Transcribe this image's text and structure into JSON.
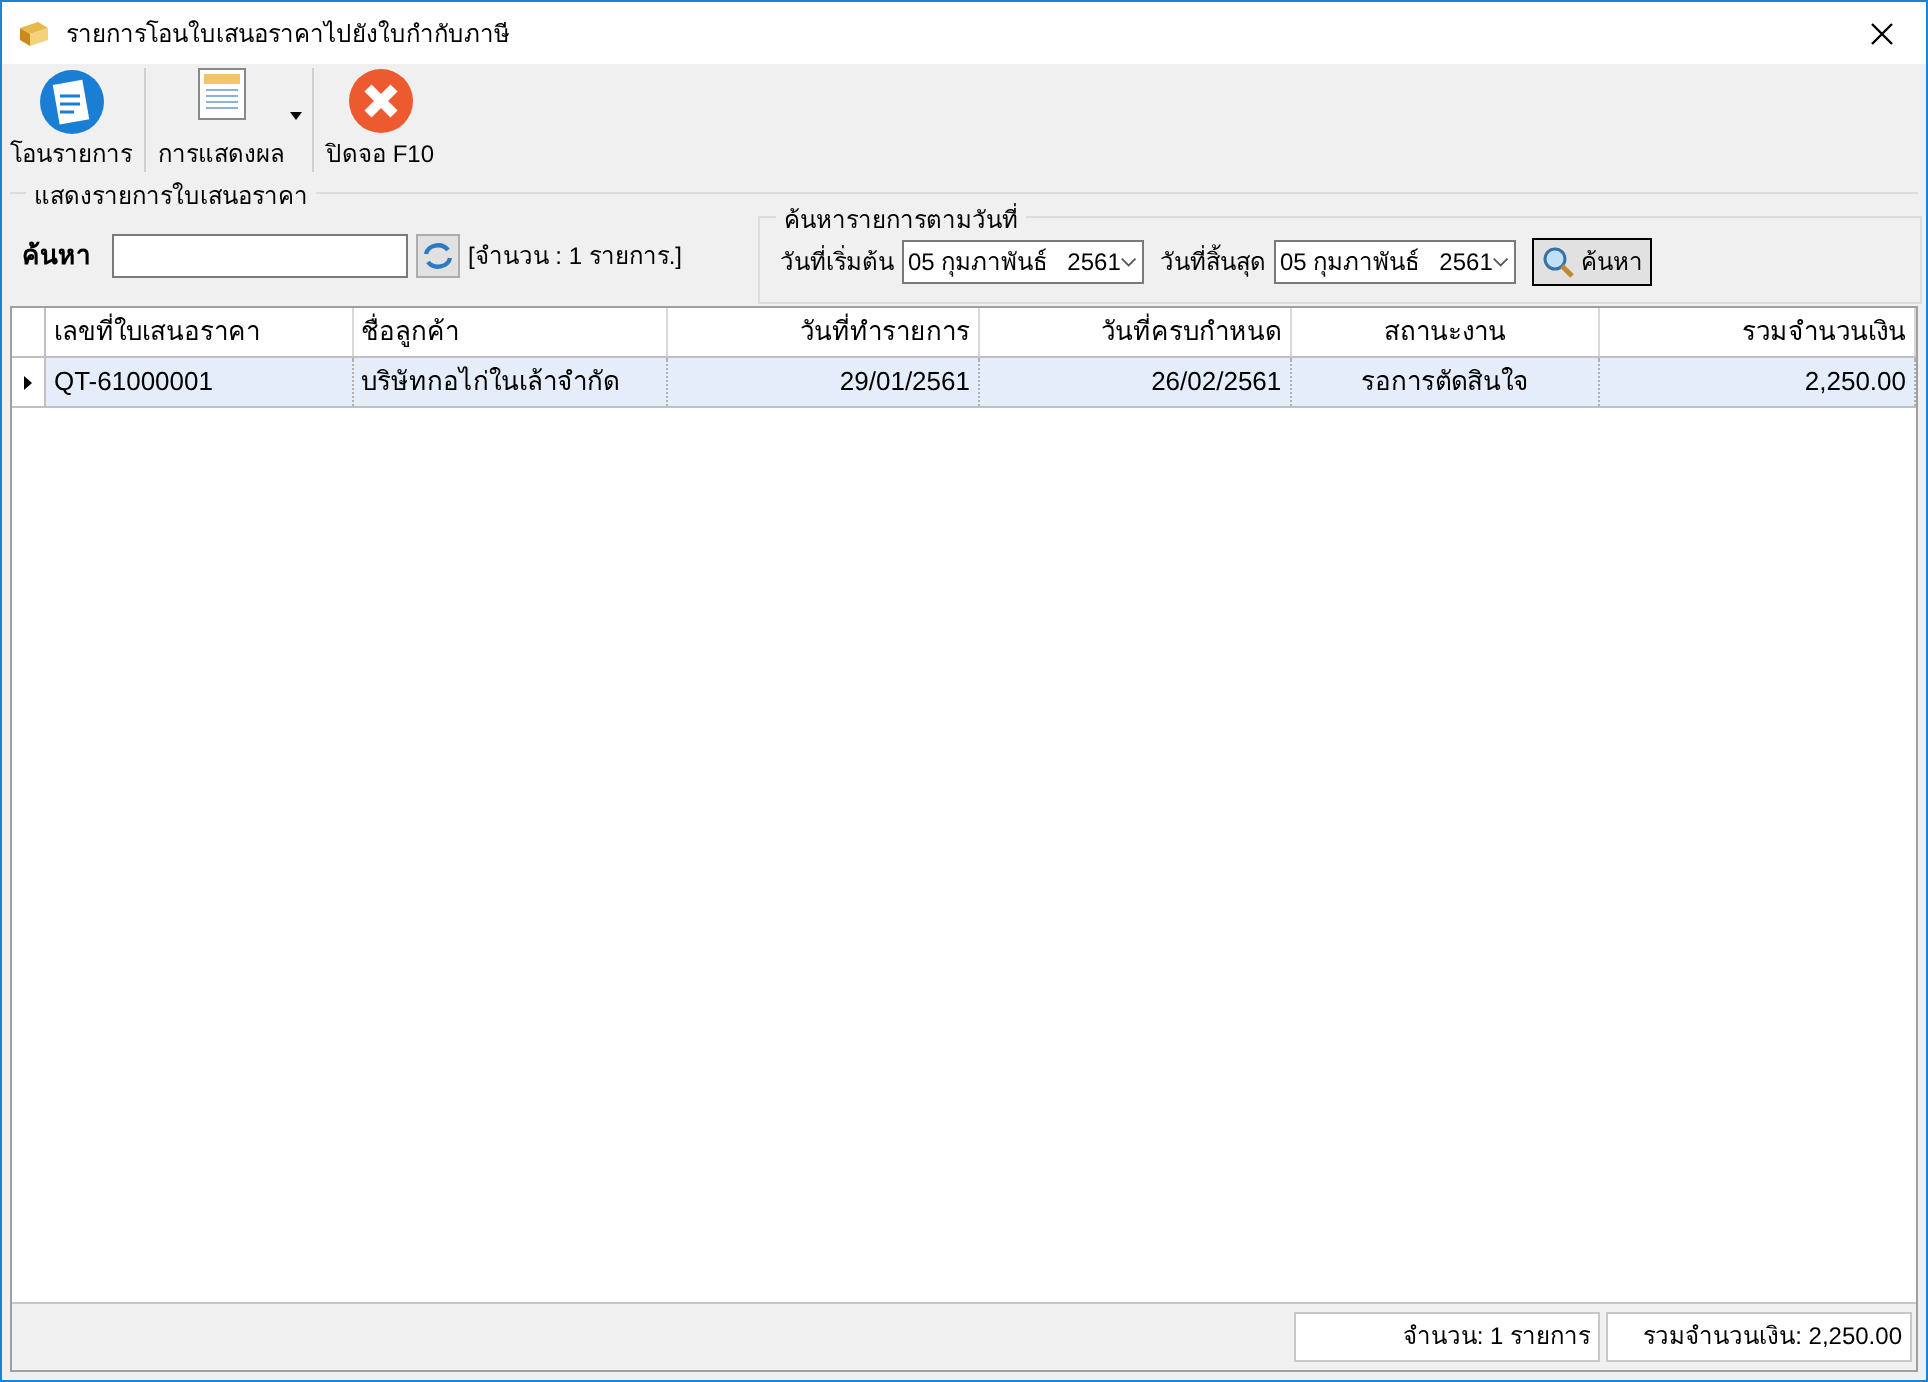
{
  "window": {
    "title": "รายการโอนใบเสนอราคาไปยังใบกำกับภาษี"
  },
  "toolbar": [
    {
      "kind": "transfer",
      "label": "โอนรายการ"
    },
    {
      "kind": "view",
      "label": "การแสดงผล"
    },
    {
      "kind": "close",
      "label": "ปิดจอ F10"
    }
  ],
  "list_group": {
    "title": "แสดงรายการใบเสนอราคา",
    "search_label": "ค้นหา",
    "count": "[จำนวน : 1 รายการ.]"
  },
  "date_group": {
    "title": "ค้นหารายการตามวันที่",
    "start_label": "วันที่เริ่มต้น",
    "start_date": "05 กุมภาพันธ์   2561",
    "end_label": "วันที่สิ้นสุด",
    "end_date": "05 กุมภาพันธ์   2561",
    "search_button": "ค้นหา"
  },
  "table": {
    "columns": [
      {
        "label": "เลขที่ใบเสนอราคา"
      },
      {
        "label": "ชื่อลูกค้า"
      },
      {
        "label": "วันที่ทำรายการ"
      },
      {
        "label": "วันที่ครบกำหนด"
      },
      {
        "label": "สถานะงาน"
      },
      {
        "label": "รวมจำนวนเงิน"
      }
    ],
    "rows": [
      {
        "selected": true,
        "cells": [
          "QT-61000001",
          "บริษัทกอไก่ในเล้าจำกัด",
          "29/01/2561",
          "26/02/2561",
          "รอการตัดสินใจ",
          "2,250.00"
        ]
      }
    ]
  },
  "status_bar": [
    "จำนวน: 1 รายการ",
    "รวมจำนวนเงิน: 2,250.00"
  ]
}
